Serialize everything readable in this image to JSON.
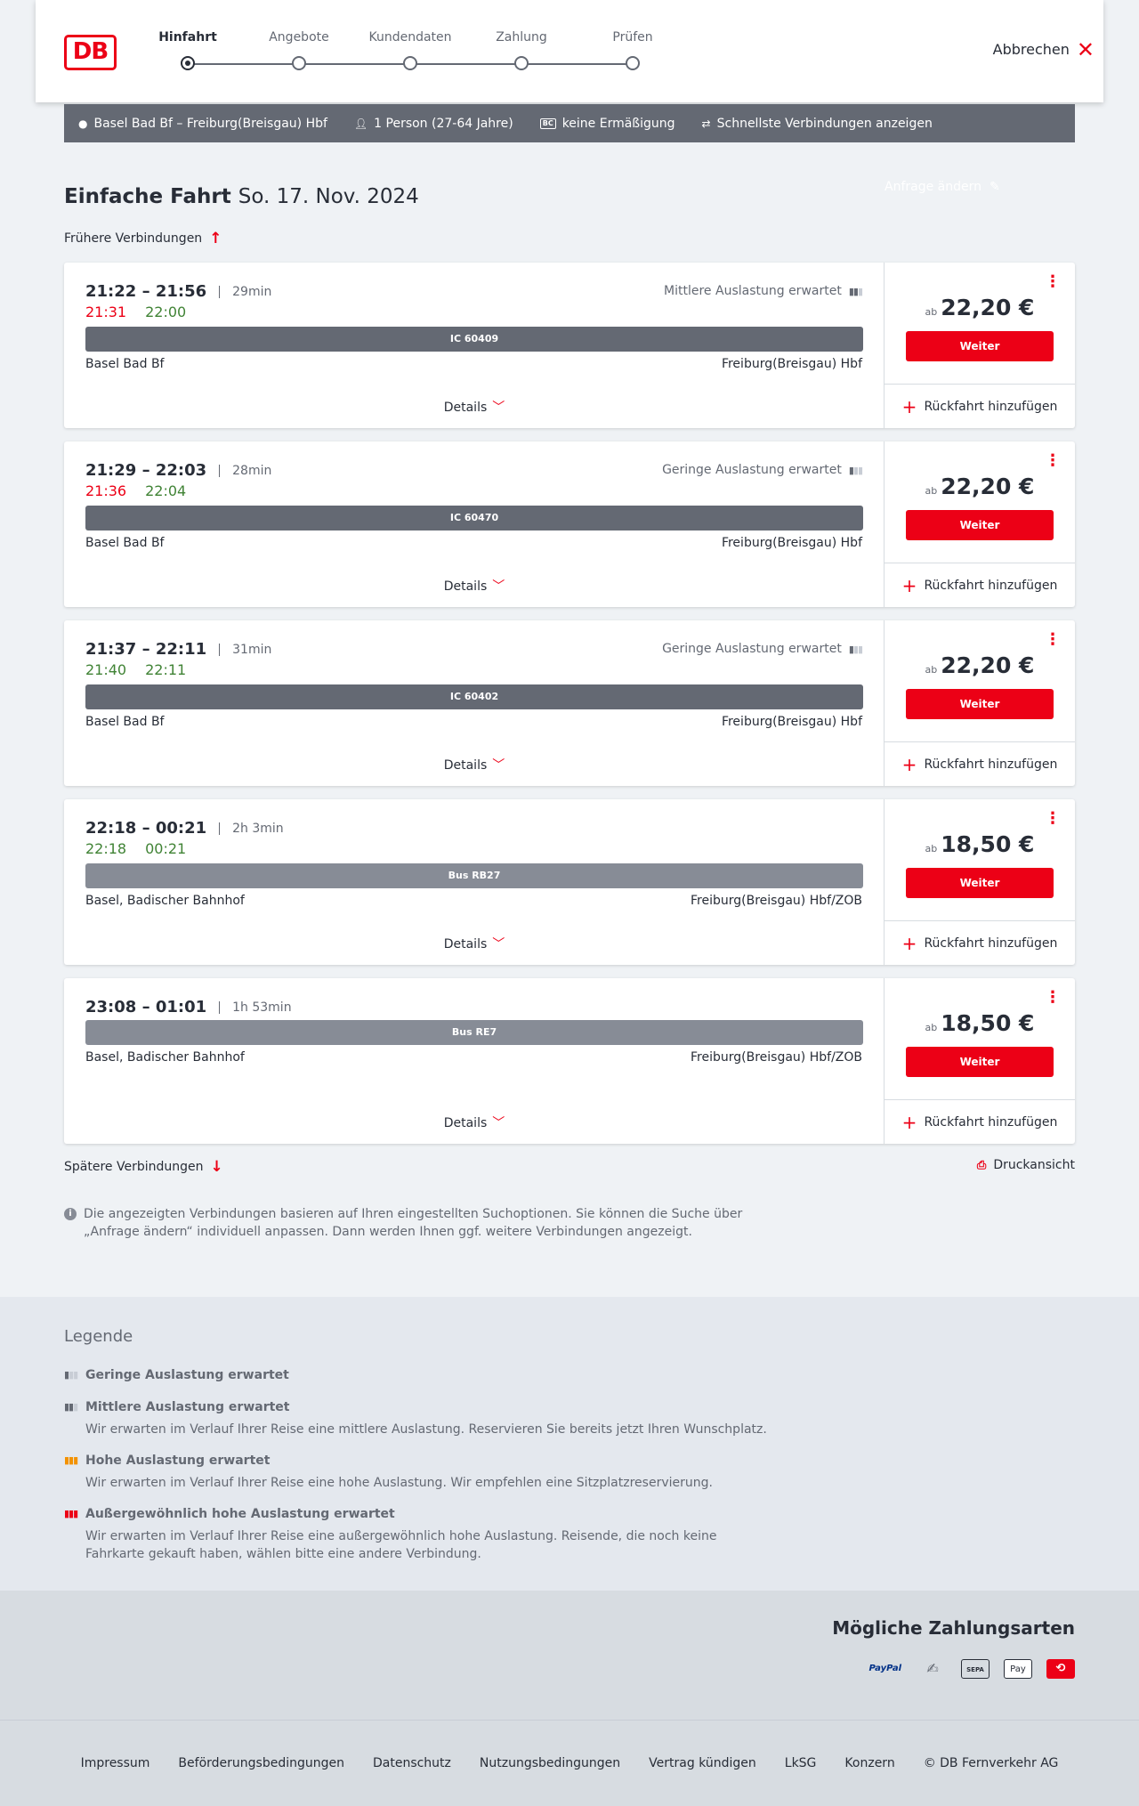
{
  "header": {
    "logo": "DB",
    "steps": [
      {
        "label": "Hinfahrt",
        "active": true
      },
      {
        "label": "Angebote",
        "active": false
      },
      {
        "label": "Kundendaten",
        "active": false
      },
      {
        "label": "Zahlung",
        "active": false
      },
      {
        "label": "Prüfen",
        "active": false
      }
    ],
    "cancel": "Abbrechen"
  },
  "search": {
    "route": "Basel Bad Bf – Freiburg(Breisgau) Hbf",
    "persons": "1 Person (27-64 Jahre)",
    "discount": "keine Ermäßigung",
    "discount_icon": "BC",
    "fastest": "Schnellste Verbindungen anzeigen",
    "edit": "Anfrage ändern"
  },
  "page": {
    "title": "Einfache Fahrt",
    "date": "So. 17. Nov. 2024",
    "earlier": "Frühere Verbindungen",
    "later": "Spätere Verbindungen",
    "print": "Druckansicht",
    "info": "Die angezeigten Verbindungen basieren auf Ihren eingestellten Suchoptionen. Sie können die Suche über „Anfrage ändern“ individuell anpassen. Dann werden Ihnen ggf. weitere Verbindungen angezeigt."
  },
  "connections": [
    {
      "times": "21:22 – 21:56",
      "duration": "29min",
      "rt_dep": "21:31",
      "rt_arr": "22:00",
      "rt_dep_color": "red",
      "rt_arr_color": "green",
      "load": "Mittlere Auslastung erwartet",
      "train": "IC 60409",
      "from": "Basel Bad Bf",
      "to": "Freiburg(Breisgau) Hbf",
      "details": "Details",
      "price_prefix": "ab",
      "price": "22,20 €",
      "button": "Weiter",
      "return": "Rückfahrt hinzufügen"
    },
    {
      "times": "21:29 – 22:03",
      "duration": "28min",
      "rt_dep": "21:36",
      "rt_arr": "22:04",
      "rt_dep_color": "red",
      "rt_arr_color": "green",
      "load": "Geringe Auslastung erwartet",
      "train": "IC 60470",
      "from": "Basel Bad Bf",
      "to": "Freiburg(Breisgau) Hbf",
      "details": "Details",
      "price_prefix": "ab",
      "price": "22,20 €",
      "button": "Weiter",
      "return": "Rückfahrt hinzufügen"
    },
    {
      "times": "21:37 – 22:11",
      "duration": "31min",
      "rt_dep": "21:40",
      "rt_arr": "22:11",
      "rt_dep_color": "green",
      "rt_arr_color": "green",
      "load": "Geringe Auslastung erwartet",
      "train": "IC 60402",
      "from": "Basel Bad Bf",
      "to": "Freiburg(Breisgau) Hbf",
      "details": "Details",
      "price_prefix": "ab",
      "price": "22,20 €",
      "button": "Weiter",
      "return": "Rückfahrt hinzufügen"
    },
    {
      "times": "22:18 – 00:21",
      "duration": "2h 3min",
      "rt_dep": "22:18",
      "rt_arr": "00:21",
      "rt_dep_color": "green",
      "rt_arr_color": "green",
      "load": "",
      "train": "Bus RB27",
      "from": "Basel, Badischer Bahnhof",
      "to": "Freiburg(Breisgau) Hbf/ZOB",
      "details": "Details",
      "price_prefix": "ab",
      "price": "18,50 €",
      "button": "Weiter",
      "return": "Rückfahrt hinzufügen"
    },
    {
      "times": "23:08 – 01:01",
      "duration": "1h 53min",
      "rt_dep": "",
      "rt_arr": "",
      "rt_dep_color": "green",
      "rt_arr_color": "green",
      "load": "",
      "train": "Bus RE7",
      "from": "Basel, Badischer Bahnhof",
      "to": "Freiburg(Breisgau) Hbf/ZOB",
      "details": "Details",
      "price_prefix": "ab",
      "price": "18,50 €",
      "button": "Weiter",
      "return": "Rückfahrt hinzufügen"
    }
  ],
  "legend": {
    "title": "Legende",
    "items": [
      {
        "title": "Geringe Auslastung erwartet",
        "desc": "",
        "color": "#646973"
      },
      {
        "title": "Mittlere Auslastung erwartet",
        "desc": "Wir erwarten im Verlauf Ihrer Reise eine mittlere Auslastung. Reservieren Sie bereits jetzt Ihren Wunschplatz.",
        "color": "#646973"
      },
      {
        "title": "Hohe Auslastung erwartet",
        "desc": "Wir erwarten im Verlauf Ihrer Reise eine hohe Auslastung. Wir empfehlen eine Sitzplatzreservierung.",
        "color": "#f39200"
      },
      {
        "title": "Außergewöhnlich hohe Auslastung erwartet",
        "desc": "Wir erwarten im Verlauf Ihrer Reise eine außergewöhnlich hohe Auslastung. Reisende, die noch keine Fahrkarte gekauft haben, wählen bitte eine andere Verbindung.",
        "color": "#ec0016"
      }
    ]
  },
  "payment": {
    "title": "Mögliche Zahlungsarten",
    "methods": [
      "PayPal",
      "SEPA",
      "Pay"
    ]
  },
  "footer": {
    "links": [
      "Impressum",
      "Beförderungsbedingungen",
      "Datenschutz",
      "Nutzungsbedingungen",
      "Vertrag kündigen",
      "LkSG",
      "Konzern",
      "© DB Fernverkehr AG"
    ]
  }
}
